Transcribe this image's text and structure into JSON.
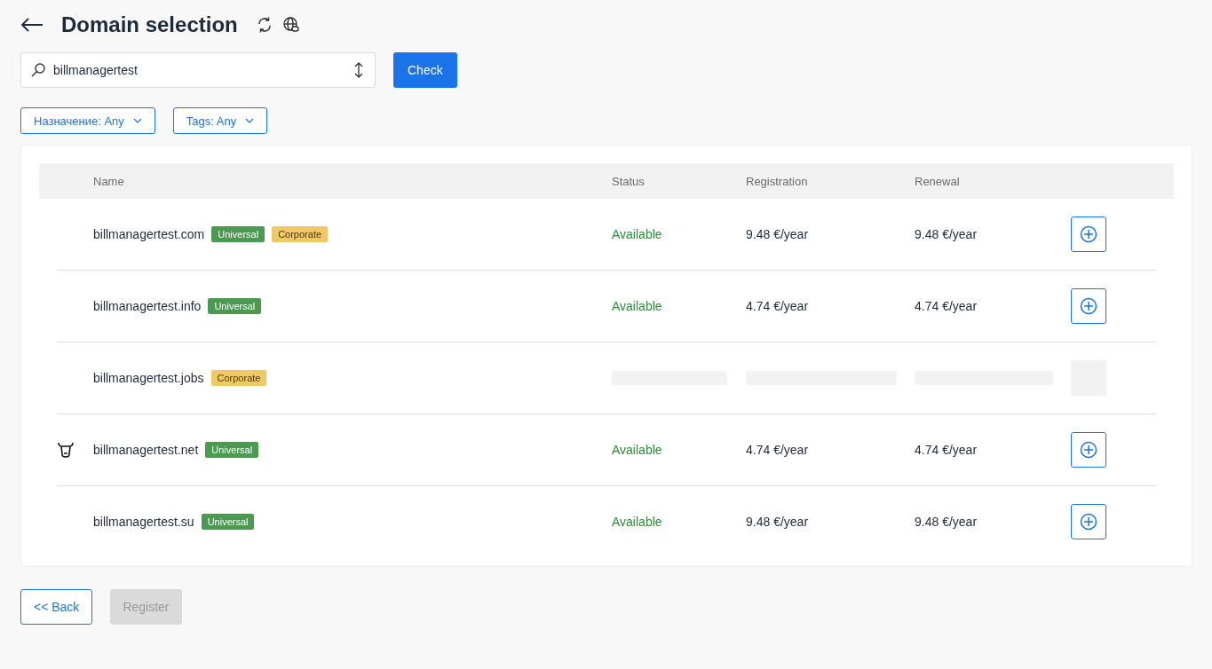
{
  "header": {
    "title": "Domain selection"
  },
  "search": {
    "value": "billmanagertest",
    "button": "Check"
  },
  "filters": [
    {
      "label": "Назначение: Any"
    },
    {
      "label": "Tags: Any"
    }
  ],
  "table": {
    "columns": [
      "Name",
      "Status",
      "Registration",
      "Renewal"
    ],
    "rows": [
      {
        "kind": "available",
        "name": "billmanagertest.com",
        "promo_icon": false,
        "tags": [
          {
            "label": "Universal",
            "kind": "universal"
          },
          {
            "label": "Corporate",
            "kind": "corporate"
          }
        ],
        "status": "Available",
        "registration": "9.48 €/year",
        "renewal": "9.48 €/year"
      },
      {
        "kind": "available",
        "name": "billmanagertest.info",
        "promo_icon": false,
        "tags": [
          {
            "label": "Universal",
            "kind": "universal"
          }
        ],
        "status": "Available",
        "registration": "4.74 €/year",
        "renewal": "4.74 €/year"
      },
      {
        "kind": "loading",
        "name": "billmanagertest.jobs",
        "promo_icon": false,
        "tags": [
          {
            "label": "Corporate",
            "kind": "corporate"
          }
        ]
      },
      {
        "kind": "available",
        "name": "billmanagertest.net",
        "promo_icon": true,
        "tags": [
          {
            "label": "Universal",
            "kind": "universal"
          }
        ],
        "status": "Available",
        "registration": "4.74 €/year",
        "renewal": "4.74 €/year"
      },
      {
        "kind": "available",
        "name": "billmanagertest.su",
        "promo_icon": false,
        "tags": [
          {
            "label": "Universal",
            "kind": "universal"
          }
        ],
        "status": "Available",
        "registration": "9.48 €/year",
        "renewal": "9.48 €/year"
      }
    ]
  },
  "footer": {
    "back": "<< Back",
    "register": {
      "label": "Register",
      "disabled": true
    }
  }
}
